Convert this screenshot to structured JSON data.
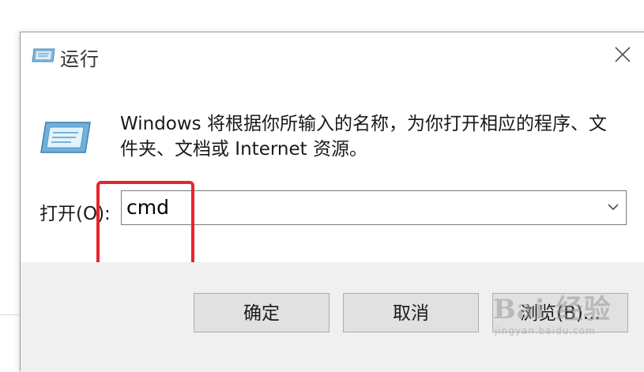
{
  "window": {
    "title": "运行",
    "icon": "run-program-icon",
    "close_icon": "close-icon"
  },
  "content": {
    "description": "Windows 将根据你所输入的名称，为你打开相应的程序、文件夹、文档或 Internet 资源。",
    "icon": "run-program-icon"
  },
  "open_field": {
    "label": "打开(O):",
    "value": "cmd",
    "dropdown_icon": "chevron-down-icon"
  },
  "buttons": {
    "ok": "确定",
    "cancel": "取消",
    "browse": "浏览(B)..."
  },
  "watermark": {
    "logo_text": "Bai 经验",
    "sub_text": "jingyan.baidu.com"
  },
  "colors": {
    "highlight_border": "#e8242a",
    "footer_background": "#f0f0f0",
    "button_background": "#e1e1e1"
  }
}
